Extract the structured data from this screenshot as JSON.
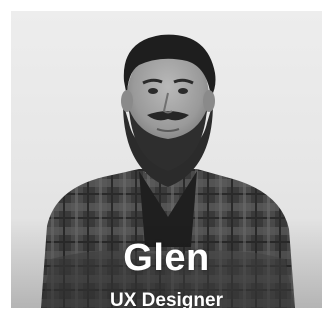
{
  "profile": {
    "name": "Glen",
    "role": "UX Designer"
  },
  "photo": {
    "icon": "person-portrait-photo"
  },
  "colors": {
    "background": "#ffffff",
    "photo_bg": "#e8e8e8",
    "text": "#ffffff"
  }
}
